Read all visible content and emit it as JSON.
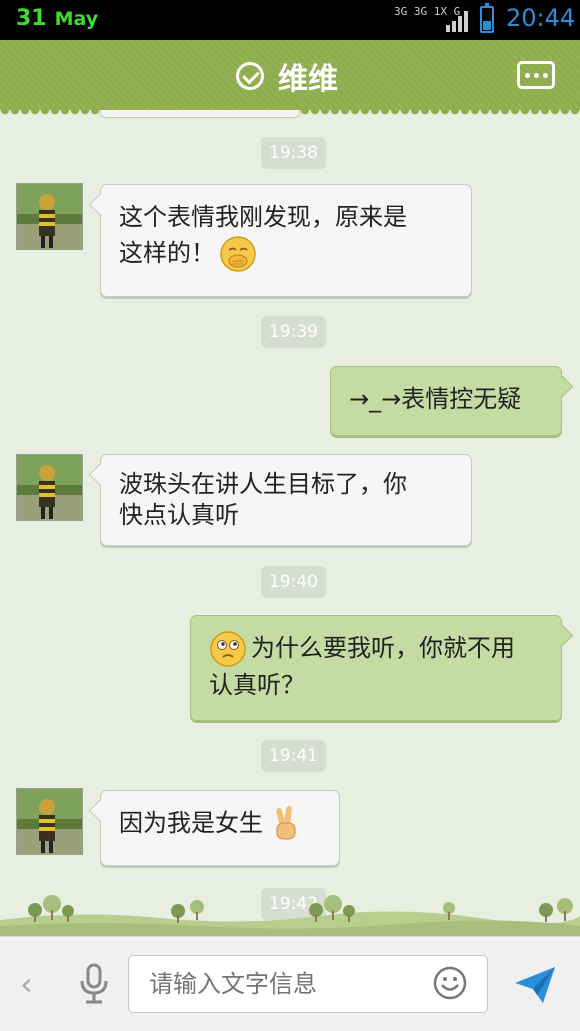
{
  "status_bar": {
    "date_day": "31",
    "date_month": "May",
    "network_top": "3G 3G 1X G",
    "time": "20:44",
    "battery_level": 0.45
  },
  "header": {
    "title": "维维",
    "check_icon": "check-circle-icon",
    "more_icon": "more-dots-icon"
  },
  "messages": [
    {
      "type": "time",
      "text": "19:38"
    },
    {
      "type": "text",
      "side": "left",
      "line1": "这个表情我刚发现，原来是",
      "line2": "这样的！",
      "emoji": "shy-hiding-emoji"
    },
    {
      "type": "time",
      "text": "19:39"
    },
    {
      "type": "text",
      "side": "right",
      "line1": "→_→表情控无疑"
    },
    {
      "type": "text",
      "side": "left",
      "line1": "波珠头在讲人生目标了，你",
      "line2": "快点认真听"
    },
    {
      "type": "time",
      "text": "19:40"
    },
    {
      "type": "text",
      "side": "right",
      "line1": "为什么要我听，你就不用",
      "line2": "认真听？",
      "emoji": "puzzled-emoji"
    },
    {
      "type": "time",
      "text": "19:41"
    },
    {
      "type": "text",
      "side": "left",
      "line1": "因为我是女生",
      "emoji": "victory-hand-emoji"
    },
    {
      "type": "time",
      "text": "19:42"
    }
  ],
  "input_bar": {
    "back_icon": "back-chevron-icon",
    "mic_icon": "microphone-icon",
    "placeholder": "请输入文字信息",
    "emoji_icon": "smiley-icon",
    "send_icon": "send-plane-icon"
  },
  "colors": {
    "header_green": "#8eae4e",
    "outgoing_bubble": "#c5dba4",
    "incoming_bubble": "#f6f6f6",
    "background": "#e9efe0",
    "time_accent": "#2a8fd8"
  }
}
